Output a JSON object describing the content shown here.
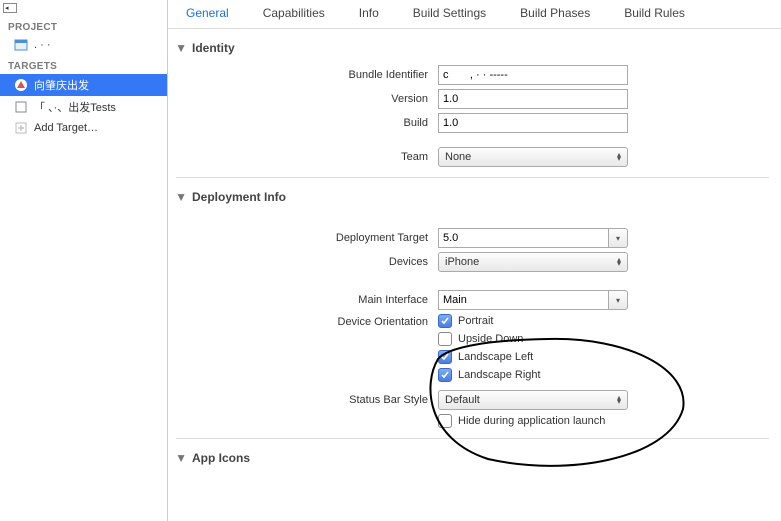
{
  "sidebar": {
    "project_header": "PROJECT",
    "project_item": ". · ·",
    "targets_header": "TARGETS",
    "target_app": "向肇庆出发",
    "target_tests": "「 、·、出发Tests",
    "add_target": "Add Target…"
  },
  "tabs": {
    "general": "General",
    "capabilities": "Capabilities",
    "info": "Info",
    "build_settings": "Build Settings",
    "build_phases": "Build Phases",
    "build_rules": "Build Rules"
  },
  "identity": {
    "title": "Identity",
    "bundle_label": "Bundle Identifier",
    "bundle_value": "c       , · · -----",
    "version_label": "Version",
    "version_value": "1.0",
    "build_label": "Build",
    "build_value": "1.0",
    "team_label": "Team",
    "team_value": "None"
  },
  "deployment": {
    "title": "Deployment Info",
    "target_label": "Deployment Target",
    "target_value": "5.0",
    "devices_label": "Devices",
    "devices_value": "iPhone",
    "main_interface_label": "Main Interface",
    "main_interface_value": "Main",
    "orientation_label": "Device Orientation",
    "portrait": "Portrait",
    "upside_down": "Upside Down",
    "landscape_left": "Landscape Left",
    "landscape_right": "Landscape Right",
    "status_bar_label": "Status Bar Style",
    "status_bar_value": "Default",
    "hide_launch": "Hide during application launch"
  },
  "app_icons": {
    "title": "App Icons"
  }
}
